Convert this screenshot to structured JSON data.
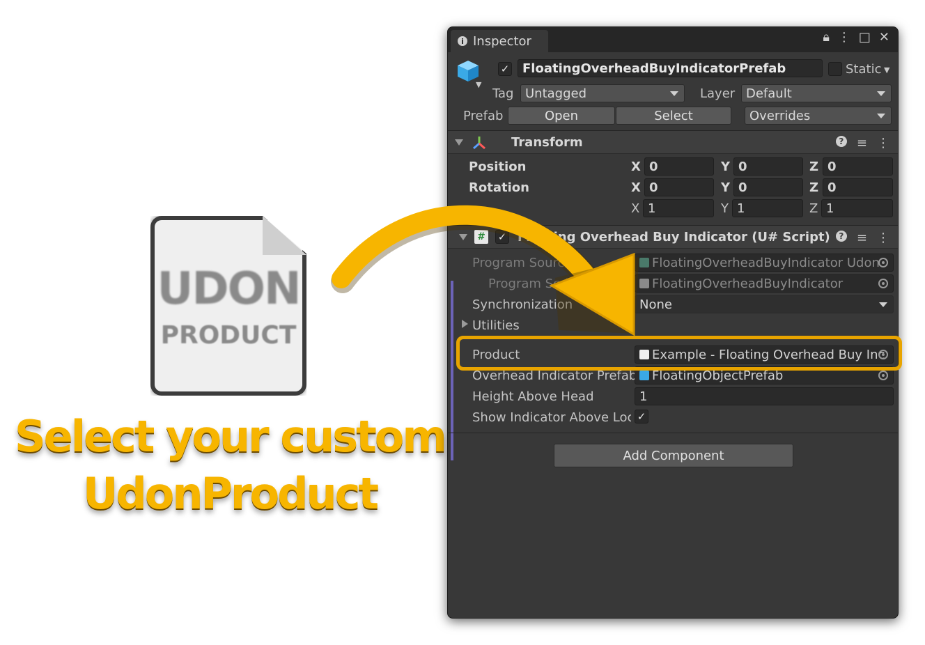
{
  "caption": {
    "line1": "Select your custom",
    "line2": "UdonProduct"
  },
  "asset_icon": {
    "name": "udon-product-asset-icon",
    "logo_line1": "UDON",
    "logo_line2": "PRODUCT"
  },
  "inspector": {
    "tab_label": "Inspector",
    "tab_tools": [
      "lock-icon",
      "kebab-menu-icon",
      "maximize-icon",
      "close-icon"
    ],
    "header": {
      "enabled": true,
      "object_name": "FloatingOverheadBuyIndicatorPrefab",
      "static_label": "Static",
      "tag_label": "Tag",
      "tag_value": "Untagged",
      "layer_label": "Layer",
      "layer_value": "Default",
      "prefab_label": "Prefab",
      "open_label": "Open",
      "select_label": "Select",
      "overrides_label": "Overrides"
    },
    "transform": {
      "title": "Transform",
      "rows": [
        {
          "label": "Position",
          "x": "0",
          "y": "0",
          "z": "0"
        },
        {
          "label": "Rotation",
          "x": "0",
          "y": "0",
          "z": "0"
        },
        {
          "label": "",
          "x": "1",
          "y": "1",
          "z": "1"
        }
      ],
      "axis_x": "X",
      "axis_y": "Y",
      "axis_z": "Z"
    },
    "script": {
      "title": "Floating Overhead Buy Indicator (U# Script)",
      "enabled": true,
      "program_source_label": "Program Source",
      "program_source_value": "FloatingOverheadBuyIndicator Udon",
      "program_script_label": "Program Script",
      "program_script_value": "FloatingOverheadBuyIndicator",
      "sync_label": "Synchronization",
      "sync_value": "None",
      "utilities_label": "Utilities",
      "product_label": "Product",
      "product_value": "Example - Floating Overhead Buy Inc",
      "overhead_prefab_label": "Overhead Indicator Prefab",
      "overhead_prefab_value": "FloatingObjectPrefab",
      "height_label": "Height Above Head",
      "height_value": "1",
      "show_label": "Show Indicator Above Loc",
      "show_value": true
    },
    "add_component_label": "Add Component"
  },
  "colors": {
    "accent_yellow": "#f7b500",
    "highlight_border": "#e8a400",
    "inspector_bg": "#383838"
  }
}
